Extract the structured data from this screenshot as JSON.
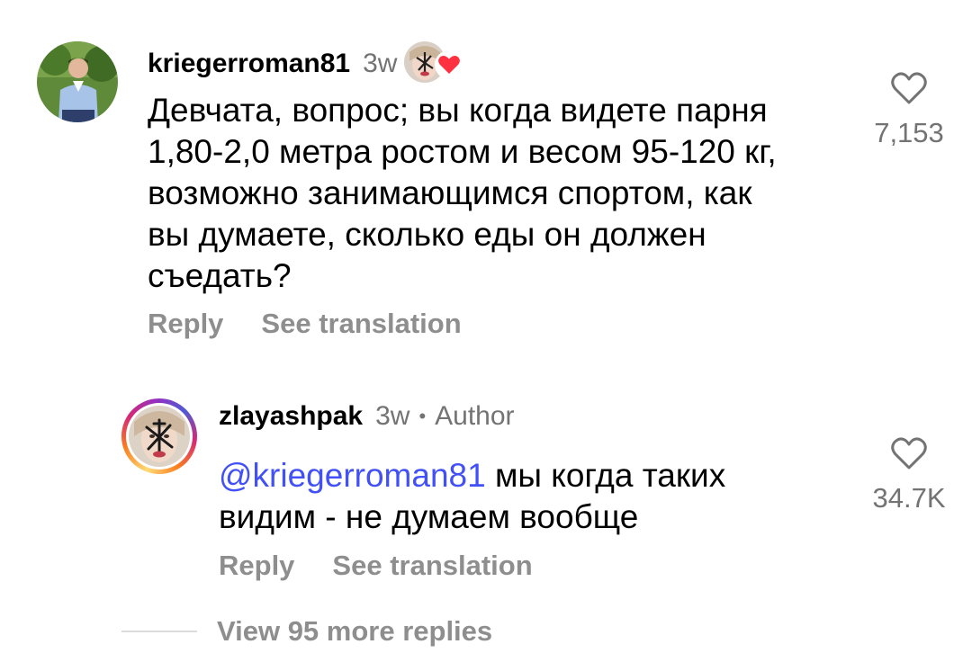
{
  "comments": [
    {
      "username": "kriegerroman81",
      "time": "3w",
      "text_lines": [
        "Девчата, вопрос; вы когда видете парня",
        "1,80-2,0 метра ростом и весом 95-120 кг,",
        "возможно занимающимся спортом, как",
        "вы думаете, сколько еды он должен",
        "съедать?"
      ],
      "like_count": "7,153",
      "reply_label": "Reply",
      "translate_label": "See translation",
      "liked_by_author_icon": "heart-icon"
    },
    {
      "username": "zlayashpak",
      "time": "3w",
      "separator": "•",
      "author_badge": "Author",
      "mention": "@kriegerroman81",
      "text_first": "мы когда таких",
      "text_second": "видим - не думаем вообще",
      "like_count": "34.7K",
      "reply_label": "Reply",
      "translate_label": "See translation"
    }
  ],
  "view_more": "View 95 more replies",
  "colors": {
    "mention": "#4150f7",
    "secondary_text": "#737373",
    "action_text": "#8e8e8e",
    "heart_red": "#ff3040"
  }
}
